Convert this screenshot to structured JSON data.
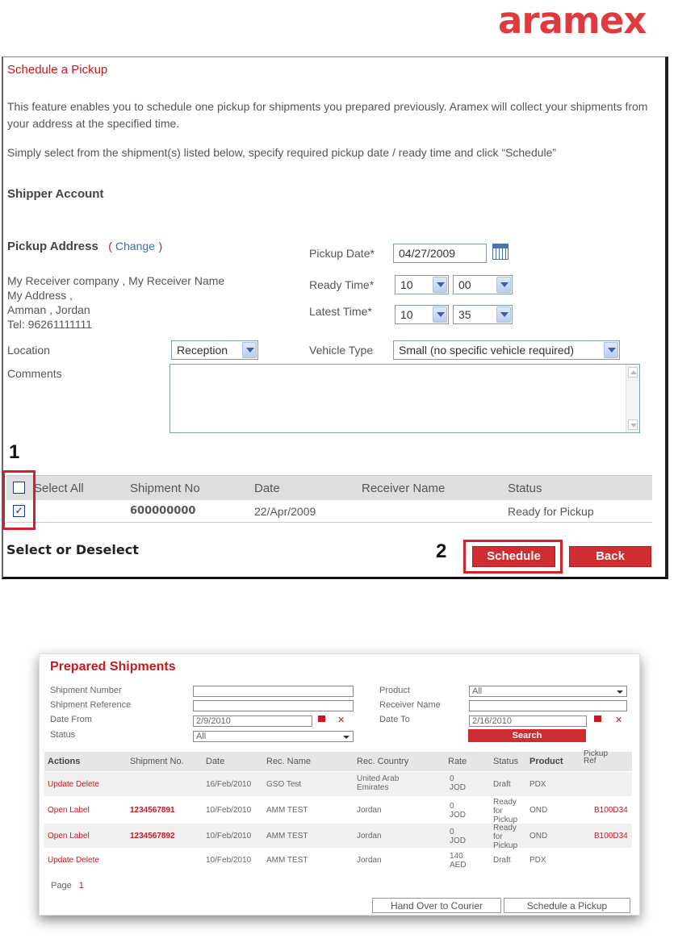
{
  "logo": "aramex",
  "pickup": {
    "title": "Schedule a Pickup",
    "intro": "This feature enables you to schedule one pickup for shipments you prepared previously. Aramex will collect your shipments from your address at the specified time.",
    "instruction": "Simply select from the shipment(s) listed below, specify required pickup date / ready time and click “Schedule”",
    "shipper_account_label": "Shipper Account",
    "pickup_address_label": "Pickup Address",
    "change_open": "(",
    "change_link": "Change",
    "change_close": ")",
    "address_lines": [
      "My Receiver company , My Receiver Name",
      "My Address ,",
      "Amman , Jordan",
      "Tel:  96261111111"
    ],
    "pickup_date_label": "Pickup Date*",
    "pickup_date_value": "04/27/2009",
    "ready_time_label": "Ready Time*",
    "ready_hour": "10",
    "ready_minute": "00",
    "latest_time_label": "Latest Time*",
    "latest_hour": "10",
    "latest_minute": "35",
    "location_label": "Location",
    "location_value": "Reception",
    "vehicle_type_label": "Vehicle Type",
    "vehicle_type_value": "Small (no specific vehicle required)",
    "comments_label": "Comments",
    "step1": "1",
    "step2": "2",
    "grid_headers": [
      "Select All",
      "Shipment No",
      "Date",
      "Receiver Name",
      "Status"
    ],
    "grid_row": {
      "shipment_no": "600000000",
      "date": "22/Apr/2009",
      "receiver_name": "",
      "status": "Ready for Pickup",
      "checked": true
    },
    "select_deselect": "Select or Deselect",
    "schedule_button": "Schedule",
    "back_button": "Back"
  },
  "prepared": {
    "title": "Prepared Shipments",
    "shipment_number_label": "Shipment Number",
    "shipment_reference_label": "Shipment Reference",
    "date_from_label": "Date From",
    "date_from_value": "2/9/2010",
    "status_label": "Status",
    "status_value": "All",
    "product_label": "Product",
    "product_value": "All",
    "receiver_name_label": "Receiver Name",
    "date_to_label": "Date To",
    "date_to_value": "2/16/2010",
    "search_button": "Search",
    "headers": [
      "Actions",
      "Shipment No.",
      "Date",
      "Rec. Name",
      "Rec. Country",
      "Rate",
      "Status",
      "Product",
      "Pickup Ref"
    ],
    "rows": [
      {
        "actions": "Update Delete",
        "shipment_no": "",
        "date": "16/Feb/2010",
        "rec_name": "GSO Test",
        "country": "United Arab Emirates",
        "rate": "0 JOD",
        "status": "Draft",
        "product": "PDX",
        "pickup_ref": ""
      },
      {
        "actions": "Open Label",
        "shipment_no": "1234567891",
        "date": "10/Feb/2010",
        "rec_name": "AMM TEST",
        "country": "Jordan",
        "rate": "0 JOD",
        "status": "Ready for Pickup",
        "product": "OND",
        "pickup_ref": "B100D34"
      },
      {
        "actions": "Open Label",
        "shipment_no": "1234567892",
        "date": "10/Feb/2010",
        "rec_name": "AMM TEST",
        "country": "Jordan",
        "rate": "0 JOD",
        "status": "Ready for Pickup",
        "product": "OND",
        "pickup_ref": "B100D34"
      },
      {
        "actions": "Update Delete",
        "shipment_no": "",
        "date": "10/Feb/2010",
        "rec_name": "AMM TEST",
        "country": "Jordan",
        "rate": "140 AED",
        "status": "Draft",
        "product": "PDX",
        "pickup_ref": ""
      }
    ],
    "page_label": "Page",
    "page_value": "1",
    "hand_over_button": "Hand Over to Courier",
    "schedule_pickup_button": "Schedule a Pickup"
  },
  "colors": {
    "brand_red": "#c8171e",
    "button_red": "#d02d33",
    "highlight_red": "#d4202a"
  }
}
